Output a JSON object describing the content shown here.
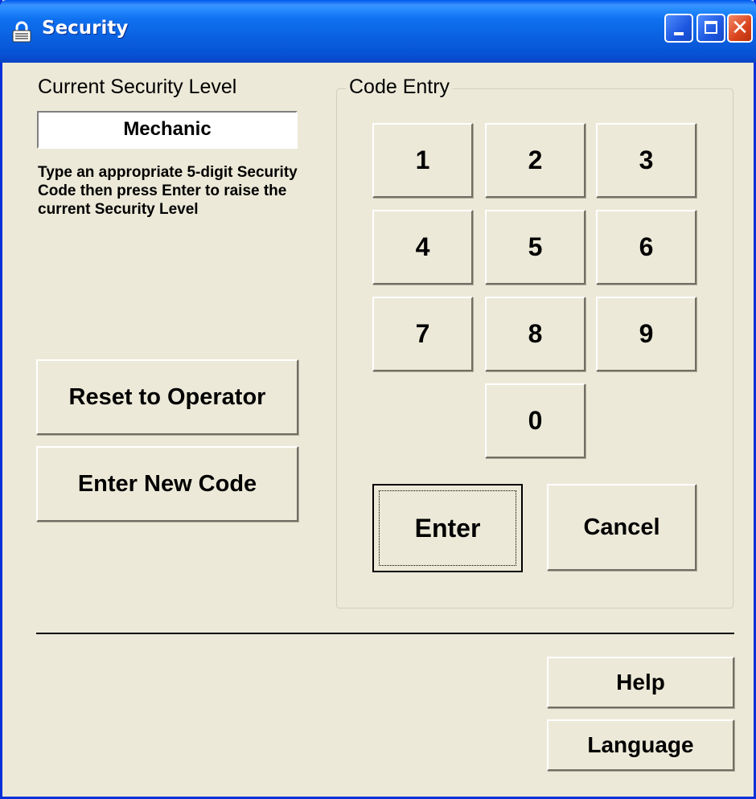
{
  "window": {
    "title": "Security",
    "title_icon": "lock-icon",
    "controls": {
      "minimize": "minimize-icon",
      "maximize": "maximize-icon",
      "close": "close-icon"
    }
  },
  "left": {
    "level_label": "Current Security Level",
    "level_value": "Mechanic",
    "instructions": "Type an appropriate 5-digit Security Code then press Enter to raise the current Security Level",
    "reset_button": "Reset to Operator",
    "new_code_button": "Enter New Code"
  },
  "code_entry": {
    "title": "Code Entry",
    "keys": [
      "1",
      "2",
      "3",
      "4",
      "5",
      "6",
      "7",
      "8",
      "9",
      "0"
    ],
    "enter": "Enter",
    "cancel": "Cancel"
  },
  "footer": {
    "help": "Help",
    "language": "Language"
  },
  "colors": {
    "titlebar": "#0a61e0",
    "window_border": "#0831d9",
    "face": "#ece9d8"
  }
}
